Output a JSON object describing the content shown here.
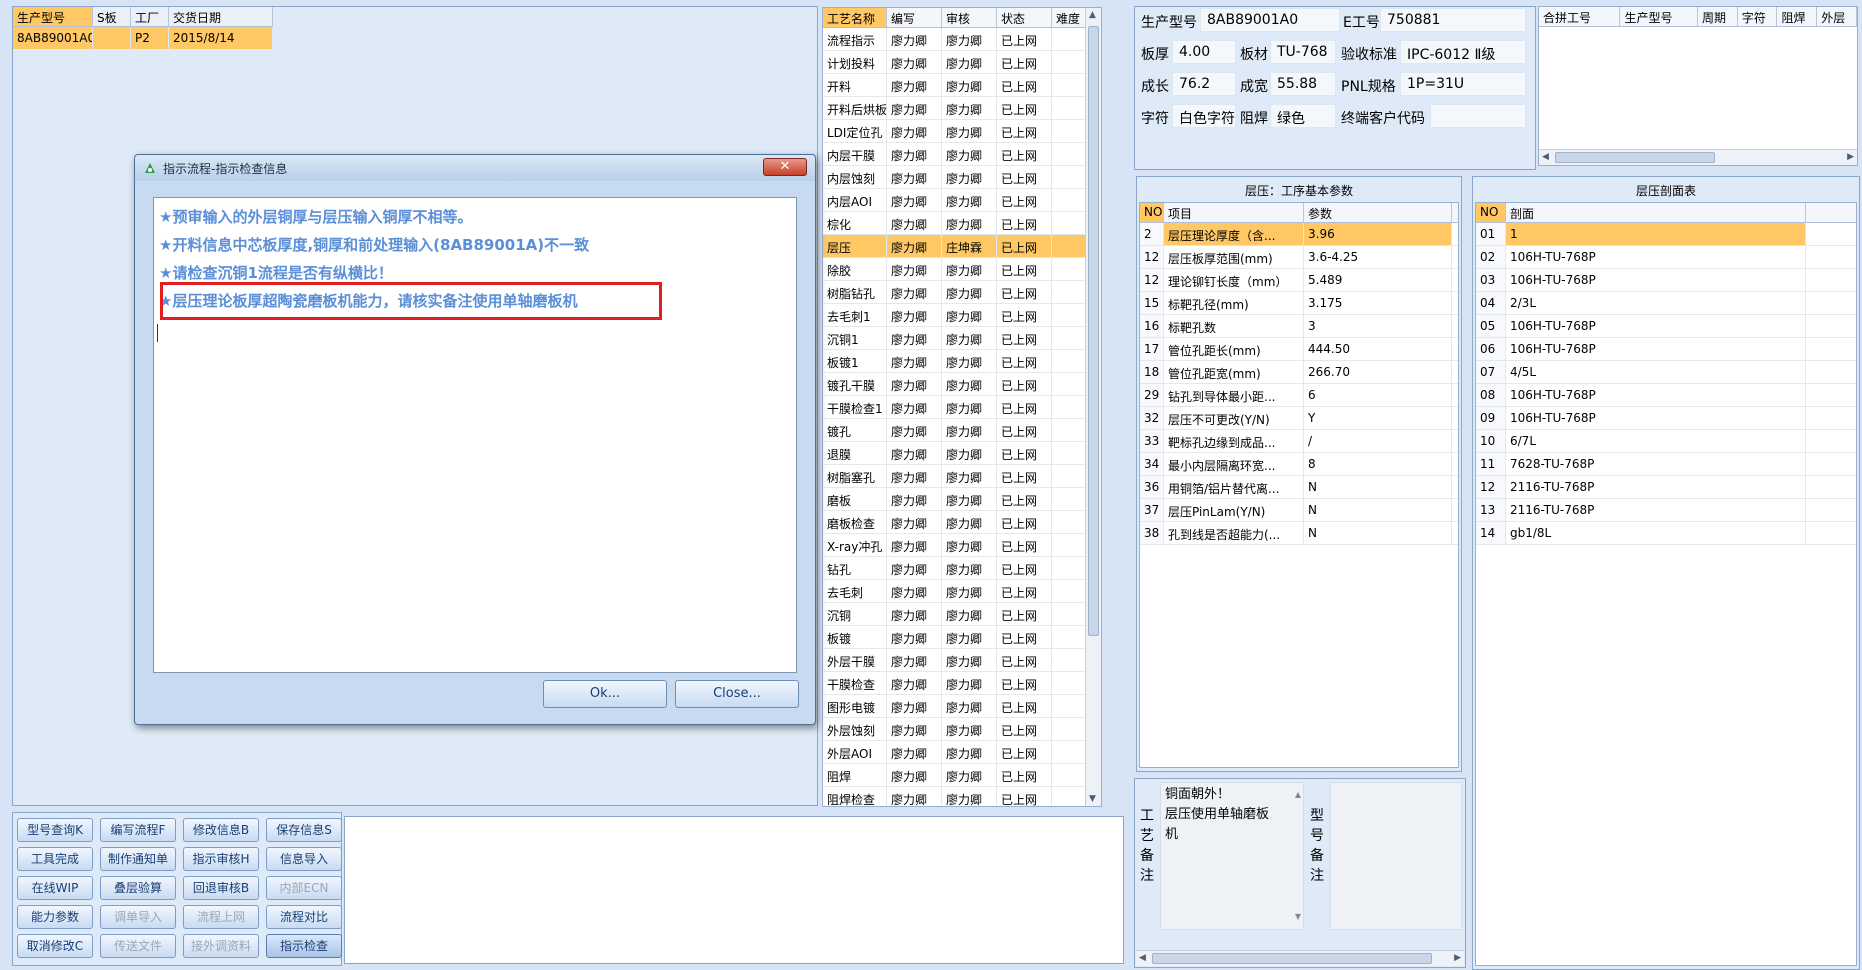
{
  "top_grid": {
    "headers": [
      "生产型号",
      "S板",
      "工厂",
      "交货日期"
    ],
    "rows": [
      [
        "8AB89001A0",
        "",
        "P2",
        "2015/8/14"
      ]
    ]
  },
  "process_grid": {
    "headers": [
      "工艺名称",
      "编写",
      "审核",
      "状态",
      "难度"
    ],
    "rows": [
      [
        "流程指示",
        "廖力卿",
        "廖力卿",
        "已上网",
        ""
      ],
      [
        "计划投料",
        "廖力卿",
        "廖力卿",
        "已上网",
        ""
      ],
      [
        "开料",
        "廖力卿",
        "廖力卿",
        "已上网",
        ""
      ],
      [
        "开料后烘板",
        "廖力卿",
        "廖力卿",
        "已上网",
        ""
      ],
      [
        "LDI定位孔",
        "廖力卿",
        "廖力卿",
        "已上网",
        ""
      ],
      [
        "内层干膜",
        "廖力卿",
        "廖力卿",
        "已上网",
        ""
      ],
      [
        "内层蚀刻",
        "廖力卿",
        "廖力卿",
        "已上网",
        ""
      ],
      [
        "内层AOI",
        "廖力卿",
        "廖力卿",
        "已上网",
        ""
      ],
      [
        "棕化",
        "廖力卿",
        "廖力卿",
        "已上网",
        ""
      ],
      [
        "层压",
        "廖力卿",
        "庄坤霖",
        "已上网",
        ""
      ],
      [
        "除胶",
        "廖力卿",
        "廖力卿",
        "已上网",
        ""
      ],
      [
        "树脂钻孔",
        "廖力卿",
        "廖力卿",
        "已上网",
        ""
      ],
      [
        "去毛刺1",
        "廖力卿",
        "廖力卿",
        "已上网",
        ""
      ],
      [
        "沉铜1",
        "廖力卿",
        "廖力卿",
        "已上网",
        ""
      ],
      [
        "板镀1",
        "廖力卿",
        "廖力卿",
        "已上网",
        ""
      ],
      [
        "镀孔干膜",
        "廖力卿",
        "廖力卿",
        "已上网",
        ""
      ],
      [
        "干膜检查1",
        "廖力卿",
        "廖力卿",
        "已上网",
        ""
      ],
      [
        "镀孔",
        "廖力卿",
        "廖力卿",
        "已上网",
        ""
      ],
      [
        "退膜",
        "廖力卿",
        "廖力卿",
        "已上网",
        ""
      ],
      [
        "树脂塞孔",
        "廖力卿",
        "廖力卿",
        "已上网",
        ""
      ],
      [
        "磨板",
        "廖力卿",
        "廖力卿",
        "已上网",
        ""
      ],
      [
        "磨板检查",
        "廖力卿",
        "廖力卿",
        "已上网",
        ""
      ],
      [
        "X-ray冲孔",
        "廖力卿",
        "廖力卿",
        "已上网",
        ""
      ],
      [
        "钻孔",
        "廖力卿",
        "廖力卿",
        "已上网",
        ""
      ],
      [
        "去毛刺",
        "廖力卿",
        "廖力卿",
        "已上网",
        ""
      ],
      [
        "沉铜",
        "廖力卿",
        "廖力卿",
        "已上网",
        ""
      ],
      [
        "板镀",
        "廖力卿",
        "廖力卿",
        "已上网",
        ""
      ],
      [
        "外层干膜",
        "廖力卿",
        "廖力卿",
        "已上网",
        ""
      ],
      [
        "干膜检查",
        "廖力卿",
        "廖力卿",
        "已上网",
        ""
      ],
      [
        "图形电镀",
        "廖力卿",
        "廖力卿",
        "已上网",
        ""
      ],
      [
        "外层蚀刻",
        "廖力卿",
        "廖力卿",
        "已上网",
        ""
      ],
      [
        "外层AOI",
        "廖力卿",
        "廖力卿",
        "已上网",
        ""
      ],
      [
        "阻焊",
        "廖力卿",
        "廖力卿",
        "已上网",
        ""
      ],
      [
        "阻焊检查",
        "廖力卿",
        "廖力卿",
        "已上网",
        ""
      ]
    ],
    "selected_index": 9
  },
  "info": {
    "model_label": "生产型号",
    "model_value": "8AB89001A0",
    "e_label": "E工号",
    "e_value": "750881",
    "thick_label": "板厚",
    "thick_value": "4.00",
    "material_label": "板材",
    "material_value": "TU-768",
    "std_label": "验收标准",
    "std_value": "IPC-6012 Ⅱ级",
    "len_label": "成长",
    "len_value": "76.2",
    "width_label": "成宽",
    "width_value": "55.88",
    "pnl_label": "PNL规格",
    "pnl_value": "1P=31U",
    "char_label": "字符",
    "char_value": "白色字符",
    "mask_label": "阻焊",
    "mask_value": "绿色",
    "cust_label": "终端客户代码",
    "cust_value": ""
  },
  "merge_grid": {
    "headers": [
      "合拼工号",
      "生产型号",
      "周期",
      "字符",
      "阻焊",
      "外层"
    ]
  },
  "params": {
    "title": "层压：工序基本参数",
    "headers": [
      "NO",
      "项目",
      "参数"
    ],
    "rows": [
      [
        "2",
        "层压理论厚度（含...",
        "3.96"
      ],
      [
        "12",
        "层压板厚范围(mm)",
        "3.6-4.25"
      ],
      [
        "12",
        "理论铆钉长度（mm）",
        "5.489"
      ],
      [
        "15",
        "标靶孔径(mm)",
        "3.175"
      ],
      [
        "16",
        "标靶孔数",
        "3"
      ],
      [
        "17",
        "管位孔距长(mm)",
        "444.50"
      ],
      [
        "18",
        "管位孔距宽(mm)",
        "266.70"
      ],
      [
        "29",
        "钻孔到导体最小距...",
        "6"
      ],
      [
        "32",
        "层压不可更改(Y/N)",
        "Y"
      ],
      [
        "33",
        "靶标孔边缘到成品...",
        "/"
      ],
      [
        "34",
        "最小内层隔离环宽...",
        "8"
      ],
      [
        "36",
        "用铜箔/铝片替代离...",
        "N"
      ],
      [
        "37",
        "层压PinLam(Y/N)",
        "N"
      ],
      [
        "38",
        "孔到线是否超能力(...",
        "N"
      ]
    ]
  },
  "stack": {
    "title": "层压剖面表",
    "headers": [
      "NO",
      "剖面"
    ],
    "rows": [
      [
        "01",
        "1"
      ],
      [
        "02",
        "106H-TU-768P"
      ],
      [
        "03",
        "106H-TU-768P"
      ],
      [
        "04",
        "2/3L"
      ],
      [
        "05",
        "106H-TU-768P"
      ],
      [
        "06",
        "106H-TU-768P"
      ],
      [
        "07",
        "4/5L"
      ],
      [
        "08",
        "106H-TU-768P"
      ],
      [
        "09",
        "106H-TU-768P"
      ],
      [
        "10",
        "6/7L"
      ],
      [
        "11",
        "7628-TU-768P"
      ],
      [
        "12",
        "2116-TU-768P"
      ],
      [
        "13",
        "2116-TU-768P"
      ],
      [
        "14",
        "gb1/8L"
      ]
    ]
  },
  "notes": {
    "craft_label": [
      "工",
      "艺",
      "备",
      "注"
    ],
    "craft_text": [
      "铜面朝外！",
      "层压使用单轴磨板",
      "机"
    ],
    "model_label": [
      "型",
      "号",
      "备",
      "注"
    ]
  },
  "buttons": [
    [
      "型号查询K",
      "编写流程F",
      "修改信息B",
      "保存信息S"
    ],
    [
      "工具完成",
      "制作通知单",
      "指示审核H",
      "信息导入"
    ],
    [
      "在线WIP",
      "叠层验算",
      "回退审核B",
      "内部ECN"
    ],
    [
      "能力参数",
      "调单导入",
      "流程上网",
      "流程对比"
    ],
    [
      "取消修改C",
      "传送文件",
      "接外调资料",
      "指示检查"
    ]
  ],
  "disabled_buttons": [
    "内部ECN",
    "调单导入",
    "流程上网",
    "传送文件",
    "接外调资料"
  ],
  "active_button": "指示检查",
  "dialog": {
    "title": "指示流程-指示检查信息",
    "messages": [
      "★预审输入的外层铜厚与层压输入铜厚不相等。",
      "★开料信息中芯板厚度,铜厚和前处理输入(8AB89001A)不一致",
      "★请检查沉铜1流程是否有纵横比！",
      "★层压理论板厚超陶瓷磨板机能力，请核实备注使用单轴磨板机"
    ],
    "ok_label": "Ok...",
    "close_label": "Close...",
    "close_icon": "x-icon",
    "highlight_color": "#e02020"
  }
}
